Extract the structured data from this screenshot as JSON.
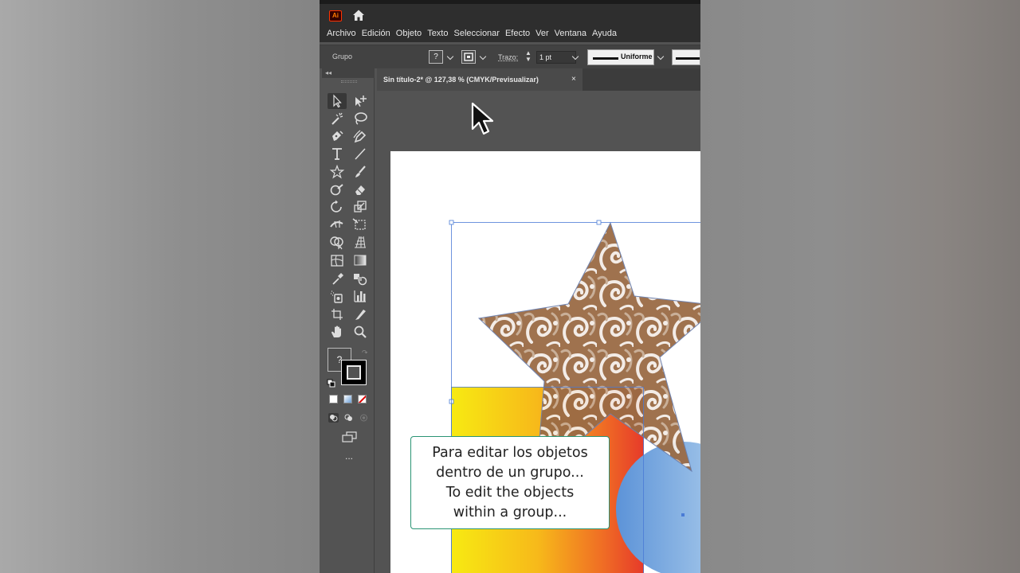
{
  "app": {
    "logo": "Ai",
    "colors": {
      "accent": "#ff7c00",
      "selection": "#4a7bd6",
      "caption_border": "#2a9474"
    }
  },
  "menu": [
    "Archivo",
    "Edición",
    "Objeto",
    "Texto",
    "Seleccionar",
    "Efecto",
    "Ver",
    "Ventana",
    "Ayuda"
  ],
  "control_bar": {
    "selection_type": "Grupo",
    "fill_swatch": "?",
    "stroke_label": "Trazo:",
    "stroke_weight": "1 pt",
    "profile_label": "Uniforme"
  },
  "document_tab": {
    "title": "Sin título-2* @ 127,38 % (CMYK/Previsualizar)",
    "close": "×"
  },
  "toolbox": {
    "collapse": "◂◂",
    "fill_unknown": "?",
    "more": "..."
  },
  "caption": {
    "line1": "Para editar los objetos",
    "line2": "dentro de un grupo...",
    "line3": "To edit the objects",
    "line4": "within a group..."
  }
}
